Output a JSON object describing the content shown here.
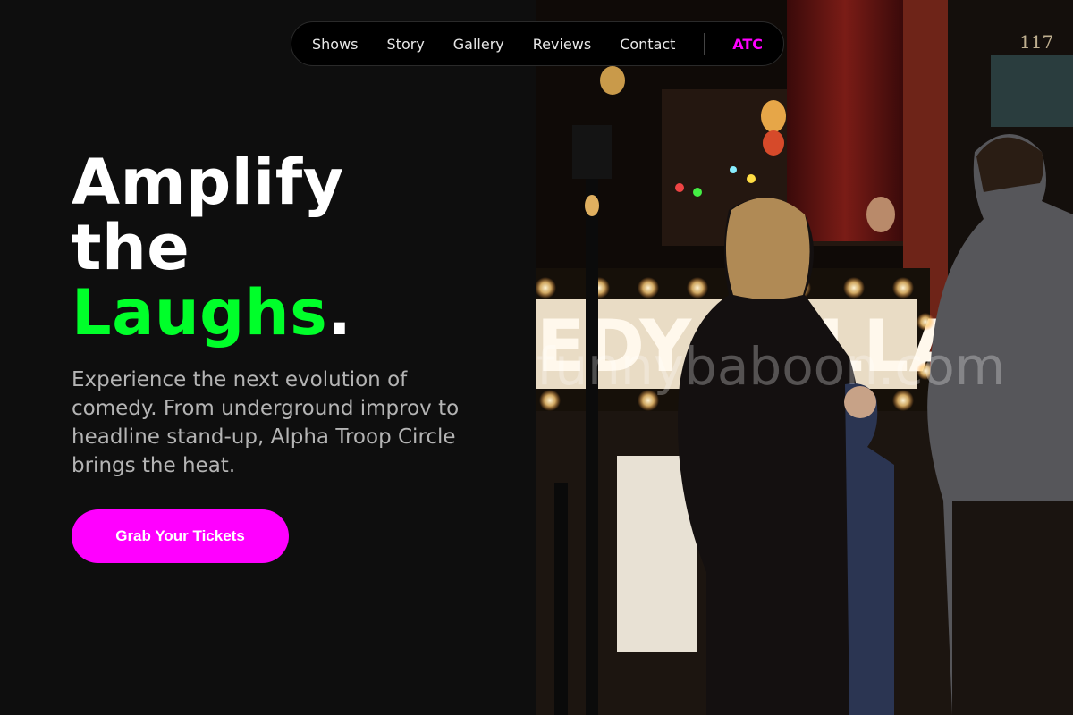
{
  "nav": {
    "links": [
      "Shows",
      "Story",
      "Gallery",
      "Reviews",
      "Contact"
    ],
    "logo": "ATC"
  },
  "hero": {
    "title_line1": "Amplify",
    "title_line2": "the",
    "title_accent": "Laughs",
    "title_period": ".",
    "description": "Experience the next evolution of comedy. From underground improv to headline stand-up, Alpha Troop Circle brings the heat.",
    "cta_label": "Grab Your Tickets"
  },
  "photo": {
    "sign_text": "EDY CELLAR",
    "address_number": "117",
    "watermark": "funnybaboon.com"
  },
  "colors": {
    "accent_green": "#00ff2a",
    "accent_magenta": "#ff00ff",
    "background": "#0e0e0e"
  }
}
